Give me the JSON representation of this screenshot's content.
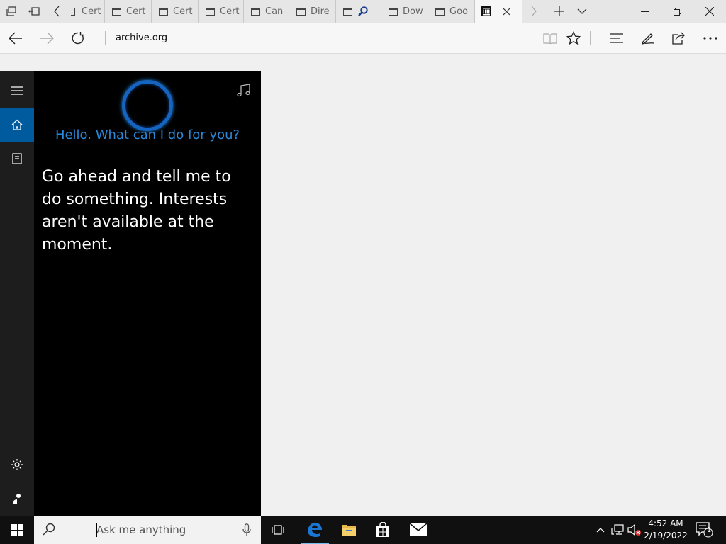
{
  "browser": {
    "tabs": [
      {
        "label": "Cert"
      },
      {
        "label": "Cert"
      },
      {
        "label": "Cert"
      },
      {
        "label": "Cert"
      },
      {
        "label": "Can"
      },
      {
        "label": "Dire"
      },
      {
        "label": ""
      },
      {
        "label": "Dow"
      },
      {
        "label": "Goo"
      }
    ],
    "address": "archive.org"
  },
  "cortana": {
    "greeting": "Hello. What can I do for you?",
    "message": "Go ahead and tell me to do something. Interests aren't available at the moment."
  },
  "taskbar": {
    "search_placeholder": "Ask me anything",
    "time": "4:52 AM",
    "date": "2/19/2022",
    "notification_count": "1"
  },
  "colors": {
    "cortana_accent": "#2b88d8",
    "rail_active": "#005a9e",
    "edge_blue": "#1976d2"
  }
}
